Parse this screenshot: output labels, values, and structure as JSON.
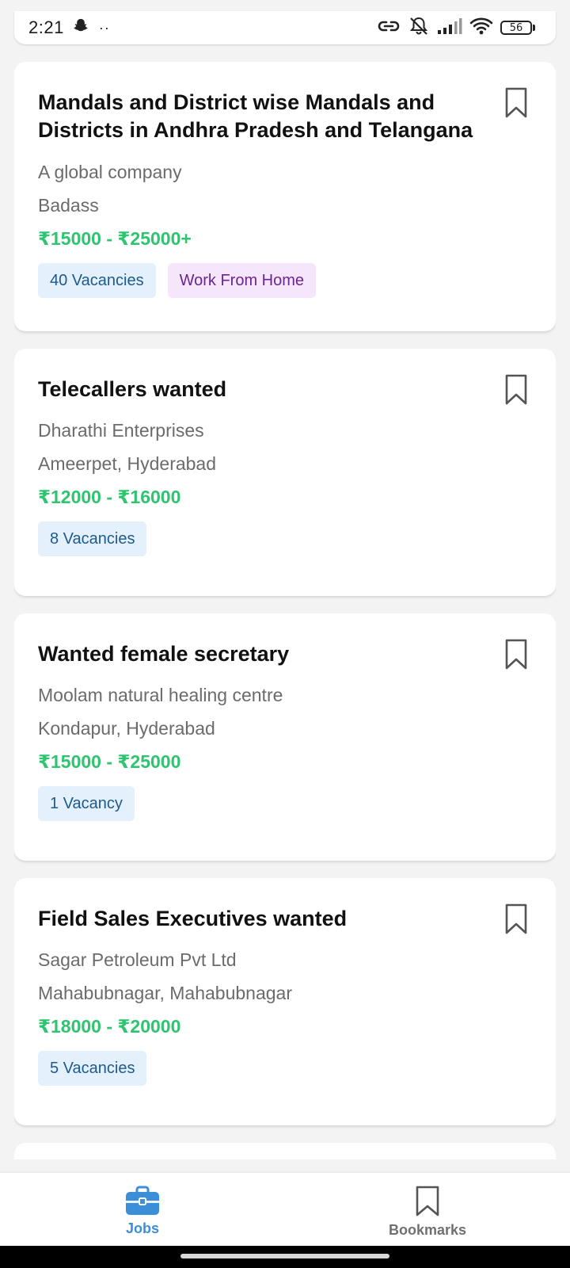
{
  "status_bar": {
    "time": "2:21",
    "dots": "··",
    "battery": "56",
    "icons": [
      "snapchat-icon",
      "link-icon",
      "bell-off-icon",
      "signal-icon",
      "wifi-icon",
      "battery-icon"
    ]
  },
  "jobs": [
    {
      "title": "Mandals and District wise Mandals and Districts in Andhra Pradesh and Telangana",
      "company": "A global company",
      "location": "Badass",
      "salary": "₹15000 - ₹25000+",
      "vacancies": "40 Vacancies",
      "extra_tag": "Work From Home"
    },
    {
      "title": "Telecallers wanted",
      "company": "Dharathi Enterprises",
      "location": "Ameerpet, Hyderabad",
      "salary": "₹12000 - ₹16000",
      "vacancies": "8 Vacancies"
    },
    {
      "title": "Wanted female secretary",
      "company": "Moolam natural healing centre",
      "location": "Kondapur, Hyderabad",
      "salary": "₹15000 - ₹25000",
      "vacancies": "1 Vacancy"
    },
    {
      "title": "Field Sales Executives wanted",
      "company": "Sagar Petroleum Pvt Ltd",
      "location": "Mahabubnagar, Mahabubnagar",
      "salary": "₹18000 - ₹20000",
      "vacancies": "5 Vacancies"
    }
  ],
  "bottom_nav": {
    "jobs_label": "Jobs",
    "bookmarks_label": "Bookmarks",
    "active": "Jobs"
  },
  "colors": {
    "salary": "#2ec470",
    "accent": "#3a8fd8",
    "vacancy_tag_bg": "#e4f0fb",
    "vacancy_tag_text": "#1e5a8c",
    "wfh_tag_bg": "#f6e6fb",
    "wfh_tag_text": "#6a2591"
  }
}
